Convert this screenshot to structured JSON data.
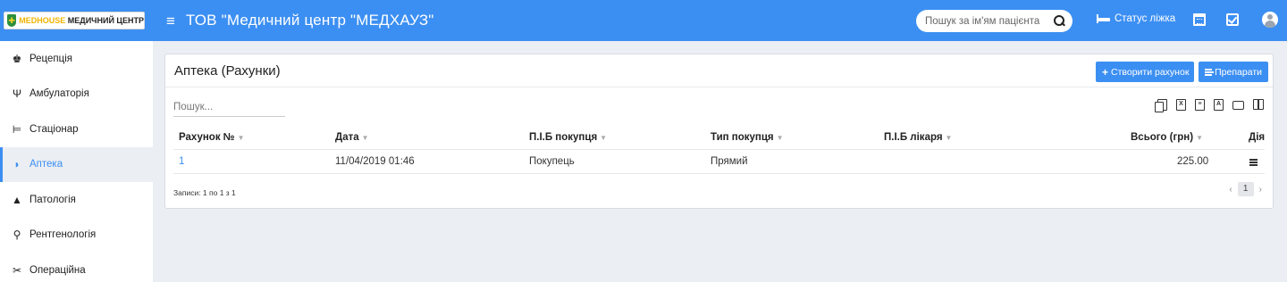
{
  "header": {
    "logo_brand": "MEDHOUSE",
    "logo_text": "МЕДИЧНИЙ ЦЕНТР",
    "org_title": "ТОВ \"Медичний центр \"МЕДХАУЗ\"",
    "search_placeholder": "Пошук за ім'ям пацієнта",
    "bed_status_label": "Статус ліжка"
  },
  "sidebar": {
    "items": [
      {
        "label": "Рецепція",
        "icon": "reception-icon"
      },
      {
        "label": "Амбулаторія",
        "icon": "stethoscope-icon"
      },
      {
        "label": "Стаціонар",
        "icon": "bed-icon"
      },
      {
        "label": "Аптека",
        "icon": "mortar-pestle-icon",
        "active": true
      },
      {
        "label": "Патологія",
        "icon": "flask-icon"
      },
      {
        "label": "Рентгенологія",
        "icon": "microscope-icon"
      },
      {
        "label": "Операційна",
        "icon": "scissors-icon"
      }
    ]
  },
  "panel": {
    "title": "Аптека (Рахунки)",
    "create_button": "Створити рахунок",
    "drugs_button": "Препарати",
    "search_placeholder": "Пошук..."
  },
  "table": {
    "columns": [
      "Рахунок №",
      "Дата",
      "П.І.Б покупця",
      "Тип покупця",
      "П.І.Б лікаря",
      "Всього (грн)",
      "Дія"
    ],
    "rows": [
      {
        "number": "1",
        "date": "11/04/2019 01:46",
        "buyer": "Покупець",
        "buyer_type": "Прямий",
        "doctor": "",
        "total": "225.00"
      }
    ],
    "records_info": "Записи: 1 по 1 з 1",
    "current_page": "1"
  },
  "colors": {
    "accent": "#3c8ff2",
    "background": "#ebeef3"
  }
}
